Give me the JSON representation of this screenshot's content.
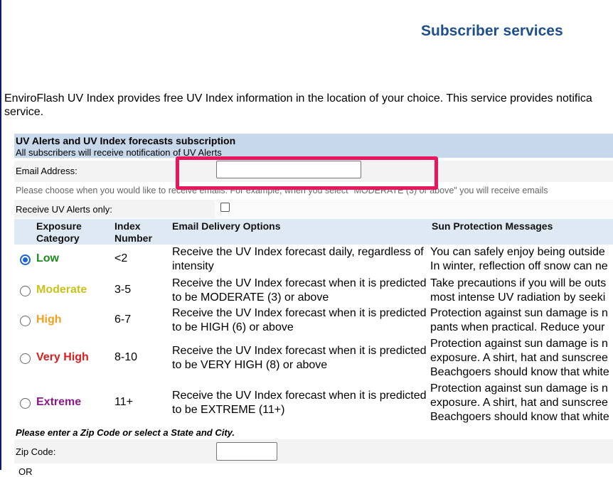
{
  "page": {
    "title": "Subscriber services",
    "intro_line1": "EnviroFlash UV Index provides free UV Index information in the location of your choice. This service provides notifica",
    "intro_line2": "service."
  },
  "form": {
    "section_title": "UV Alerts and UV Index forecasts subscription",
    "section_subtitle": "All subscribers will receive notification of UV Alerts",
    "email_label": "Email Address:",
    "email_value": "",
    "hint_text": "Please choose when you would like to receive emails. For example, when you select \"MODERATE (3) or above\" you will receive emails",
    "alerts_only_label": "Receive UV Alerts only:",
    "alerts_only_checked": false,
    "headers": {
      "category_line1": "Exposure",
      "category_line2": "Category",
      "index_line1": "Index",
      "index_line2": "Number",
      "delivery": "Email Delivery Options",
      "messages": "Sun Protection Messages"
    },
    "options": [
      {
        "category": "Low",
        "color": "#1e8a1e",
        "index": "<2",
        "selected": true,
        "delivery": "Receive the UV Index forecast daily, regardless of intensity",
        "message_lines": [
          "You can safely enjoy being outside",
          "In winter, reflection off snow can ne"
        ]
      },
      {
        "category": "Moderate",
        "color": "#c9c21c",
        "index": "3-5",
        "selected": false,
        "delivery": "Receive the UV Index forecast when it is predicted to be MODERATE (3) or above",
        "message_lines": [
          "Take precautions if you will be outs",
          "most intense UV radiation by seeki"
        ]
      },
      {
        "category": "High",
        "color": "#f0a020",
        "index": "6-7",
        "selected": false,
        "delivery": "Receive the UV Index forecast when it is predicted to be HIGH (6) or above",
        "message_lines": [
          "Protection against sun damage is n",
          "pants when practical. Reduce your"
        ]
      },
      {
        "category": "Very High",
        "color": "#d62020",
        "index": "8-10",
        "selected": false,
        "delivery": "Receive the UV Index forecast when it is predicted to be VERY HIGH (8) or above",
        "message_lines": [
          "Protection against sun damage is n",
          "exposure. A shirt, hat and sunscree",
          "Beachgoers should know that white"
        ]
      },
      {
        "category": "Extreme",
        "color": "#8a1a8a",
        "index": "11+",
        "selected": false,
        "delivery": "Receive the UV Index forecast when it is predicted to be EXTREME (11+)",
        "message_lines": [
          "Protection against sun damage is n",
          "exposure. A shirt, hat and sunscree",
          "Beachgoers should know that white"
        ]
      }
    ],
    "zip_prompt": "Please enter a Zip Code or select a State and City.",
    "zip_label": "Zip Code:",
    "zip_value": "",
    "or_text": "OR"
  },
  "highlight_color": "#e8175d"
}
